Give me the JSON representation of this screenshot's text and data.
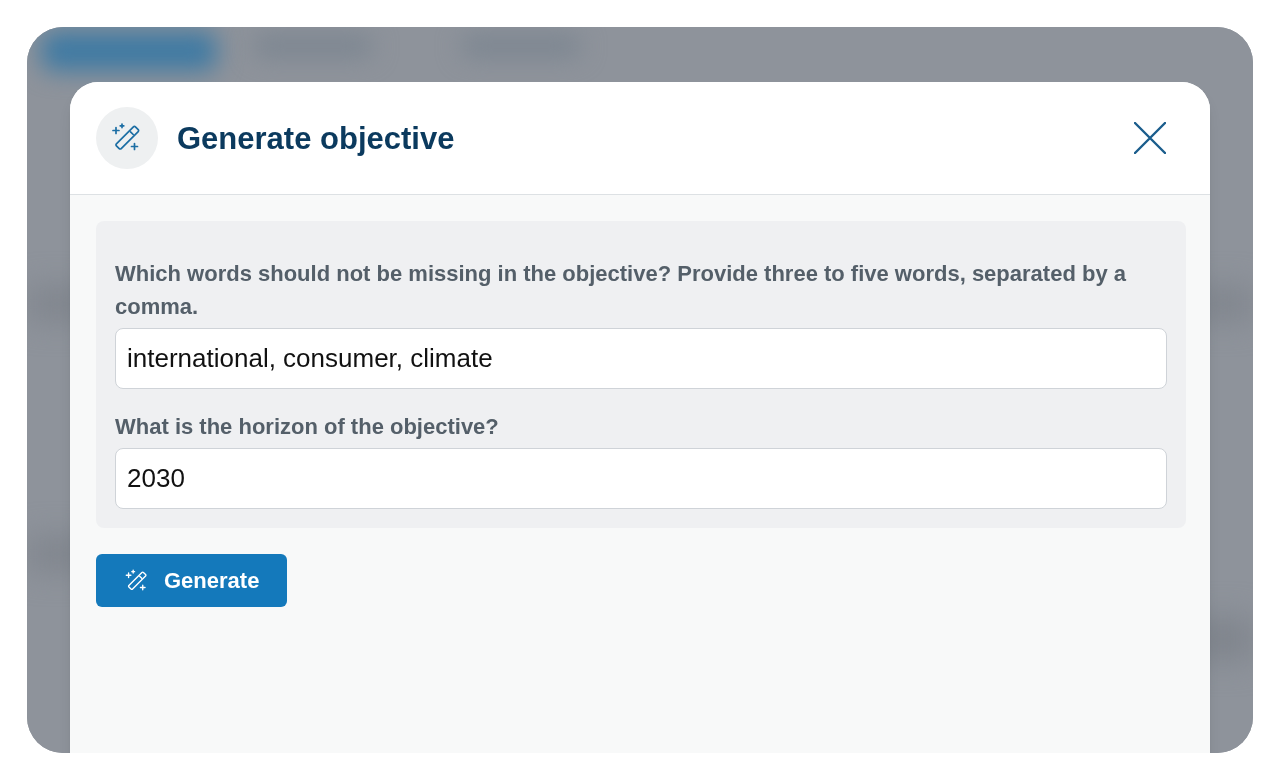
{
  "dialog": {
    "title": "Generate objective",
    "fields": [
      {
        "label": "Which words should not be missing in the objective? Provide three to five words, separated by a comma.",
        "value": "international, consumer, climate"
      },
      {
        "label": "What is the horizon of the objective?",
        "value": "2030"
      }
    ],
    "button": {
      "label": "Generate"
    }
  }
}
